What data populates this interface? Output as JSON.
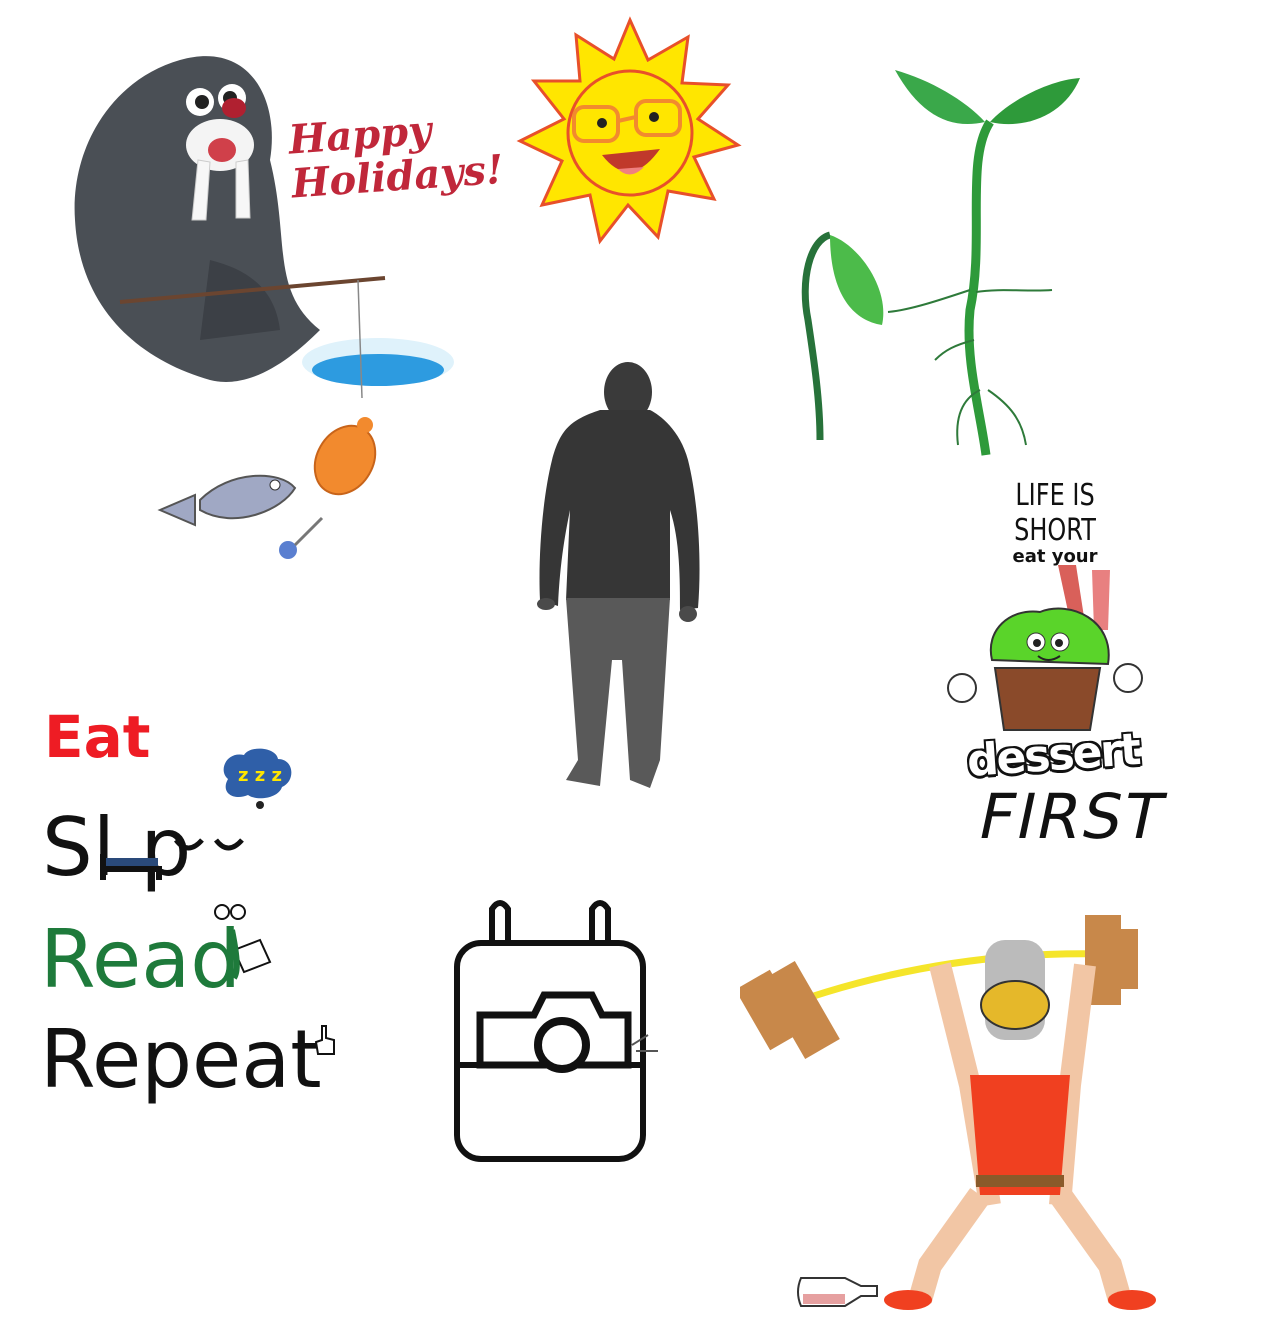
{
  "stickers": {
    "walrus": {
      "greeting_line1": "Happy",
      "greeting_line2": "Holidays!"
    },
    "dessert": {
      "line1": "LIFE IS SHORT",
      "line2": "eat your",
      "line3": "dessert",
      "line4": "FIRST"
    },
    "routine": {
      "eat": "Eat",
      "sleep": "Sl  p",
      "read": "Read",
      "repeat": "Repeat"
    }
  },
  "icons": [
    "walrus-fishing-icon",
    "sun-with-glasses-icon",
    "sprout-icon",
    "walking-man-silhouette-icon",
    "cupcake-icon",
    "camera-bag-icon",
    "weightlifter-icon",
    "bottle-icon"
  ],
  "colors": {
    "holiday_red": "#c0273a",
    "sun_yellow": "#ffe600",
    "sun_outline": "#e8502a",
    "sprout_green": "#2e9a3a",
    "silhouette": "#3a3a3a",
    "eat_red": "#ee1c24",
    "read_green": "#1e7a3b",
    "singlet_red": "#f04020",
    "barbell_yellow": "#f5e52a"
  }
}
